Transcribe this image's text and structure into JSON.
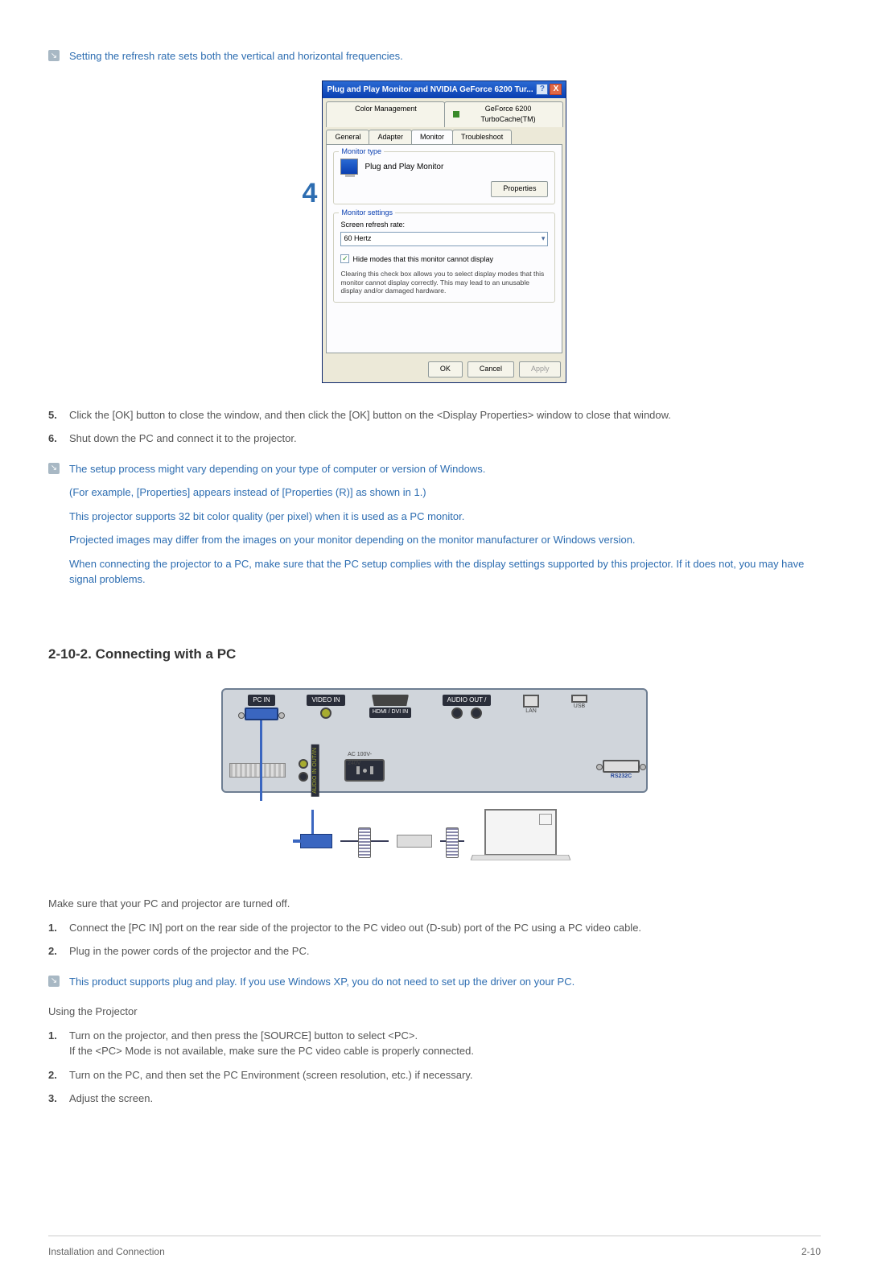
{
  "top_note": "Setting the refresh rate sets both the vertical and horizontal frequencies.",
  "step_marker": "4",
  "dialog": {
    "title": "Plug and Play Monitor and NVIDIA GeForce 6200 Tur...",
    "help_btn": "?",
    "close_btn": "X",
    "tabs_top": {
      "color_mgmt": "Color Management",
      "geforce": "GeForce 6200 TurboCache(TM)"
    },
    "tabs_bottom": {
      "general": "General",
      "adapter": "Adapter",
      "monitor": "Monitor",
      "troubleshoot": "Troubleshoot"
    },
    "monitor_type": {
      "legend": "Monitor type",
      "name": "Plug and Play Monitor",
      "properties_btn": "Properties"
    },
    "monitor_settings": {
      "legend": "Monitor settings",
      "refresh_label": "Screen refresh rate:",
      "refresh_value": "60 Hertz",
      "hide_modes": "Hide modes that this monitor cannot display",
      "warning": "Clearing this check box allows you to select display modes that this monitor cannot display correctly. This may lead to an unusable display and/or damaged hardware."
    },
    "buttons": {
      "ok": "OK",
      "cancel": "Cancel",
      "apply": "Apply"
    }
  },
  "steps_a": [
    {
      "n": "5.",
      "t": "Click the [OK] button to close the window, and then click the [OK] button on the <Display Properties> window to close that window."
    },
    {
      "n": "6.",
      "t": "Shut down the PC and connect it to the projector."
    }
  ],
  "notes_block": [
    "The setup process might vary depending on your type of computer or version of Windows.",
    "(For example, [Properties] appears instead of [Properties (R)] as shown in 1.)",
    "This projector supports 32 bit color quality (per pixel) when it is used as a PC monitor.",
    "Projected images may differ from the images on your monitor depending on the monitor manufacturer or Windows version.",
    "When connecting the projector to a PC, make sure that the PC setup complies with the display settings supported by this projector. If it does not, you may have signal problems."
  ],
  "section2_title": "2-10-2. Connecting with a PC",
  "panel": {
    "pc_in": "PC IN",
    "video_in": "VIDEO IN",
    "hdmi": "HDMI / DVI IN",
    "audio_out": "AUDIO OUT /",
    "lan": "LAN",
    "usb": "USB",
    "audio_in": "AUDIO IN OUT/IN",
    "ac": "AC 100V-240V",
    "rs232c": "RS232C"
  },
  "after_panel": "Make sure that your PC and projector are turned off.",
  "steps_b": [
    {
      "n": "1.",
      "t": "Connect the [PC IN] port on the rear side of the projector to the PC video out (D-sub) port of the PC using a PC video cable."
    },
    {
      "n": "2.",
      "t": "Plug in the power cords of the projector and the PC."
    }
  ],
  "plug_play_note": "This product supports plug and play. If you use Windows XP, you do not need to set up the driver on your PC.",
  "using_title": "Using the Projector",
  "steps_c": [
    {
      "n": "1.",
      "t": "Turn on the projector, and then  press the [SOURCE] button to select <PC>.\nIf the <PC> Mode is not available, make sure the PC video cable is properly connected."
    },
    {
      "n": "2.",
      "t": "Turn on the PC, and then set the PC Environment (screen resolution, etc.) if necessary."
    },
    {
      "n": "3.",
      "t": "Adjust the screen."
    }
  ],
  "footer": {
    "left": "Installation and Connection",
    "right": "2-10"
  }
}
